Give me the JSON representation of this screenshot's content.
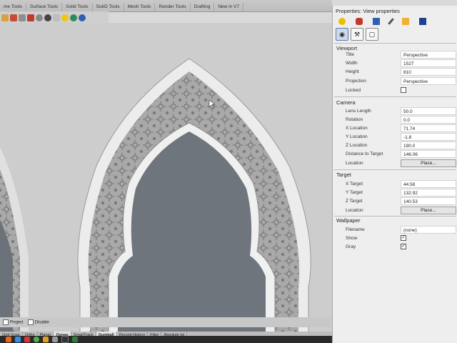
{
  "tabs": [
    "me Tools",
    "Surface Tools",
    "Solid Tools",
    "SubD Tools",
    "Mesh Tools",
    "Render Tools",
    "Drafting",
    "New in V7"
  ],
  "panel": {
    "title": "Properties: View properties",
    "sections": {
      "viewport": "Viewport",
      "camera": "Camera",
      "target": "Target",
      "wallpaper": "Wallpaper"
    },
    "viewport": {
      "title_label": "Title",
      "title_value": "Perspective",
      "width_label": "Width",
      "width_value": "1527",
      "height_label": "Height",
      "height_value": "810",
      "projection_label": "Projection",
      "projection_value": "Perspective",
      "locked_label": "Locked",
      "locked": false
    },
    "camera": {
      "lens_label": "Lens Length",
      "lens_value": "50.0",
      "rotation_label": "Rotation",
      "rotation_value": "0.0",
      "xloc_label": "X Location",
      "xloc_value": "71.74",
      "yloc_label": "Y Location",
      "yloc_value": "-1.8",
      "zloc_label": "Z Location",
      "zloc_value": "190.0",
      "dist_label": "Distance to Target",
      "dist_value": "146.06",
      "location_label": "Location",
      "place_button": "Place..."
    },
    "target": {
      "x_label": "X Target",
      "x_value": "44.58",
      "y_label": "Y Target",
      "y_value": "132.92",
      "z_label": "Z Target",
      "z_value": "140.53",
      "location_label": "Location",
      "place_button": "Place..."
    },
    "wallpaper": {
      "filename_label": "Filename",
      "filename_value": "(none)",
      "show_label": "Show",
      "show": true,
      "gray_label": "Gray",
      "gray": true
    }
  },
  "statusbar": {
    "project_label": "Project",
    "disable_label": "Disable"
  },
  "modes": [
    "Grid Snap",
    "Ortho",
    "Planar",
    "Osnap",
    "SmartTrack",
    "Gumball",
    "Record History",
    "Filter",
    "Absolute tol"
  ],
  "colors": {
    "panel_bg": "#eeeeee",
    "viewport_bg": "#cfcfcf",
    "selection": "#5a7bb5"
  }
}
